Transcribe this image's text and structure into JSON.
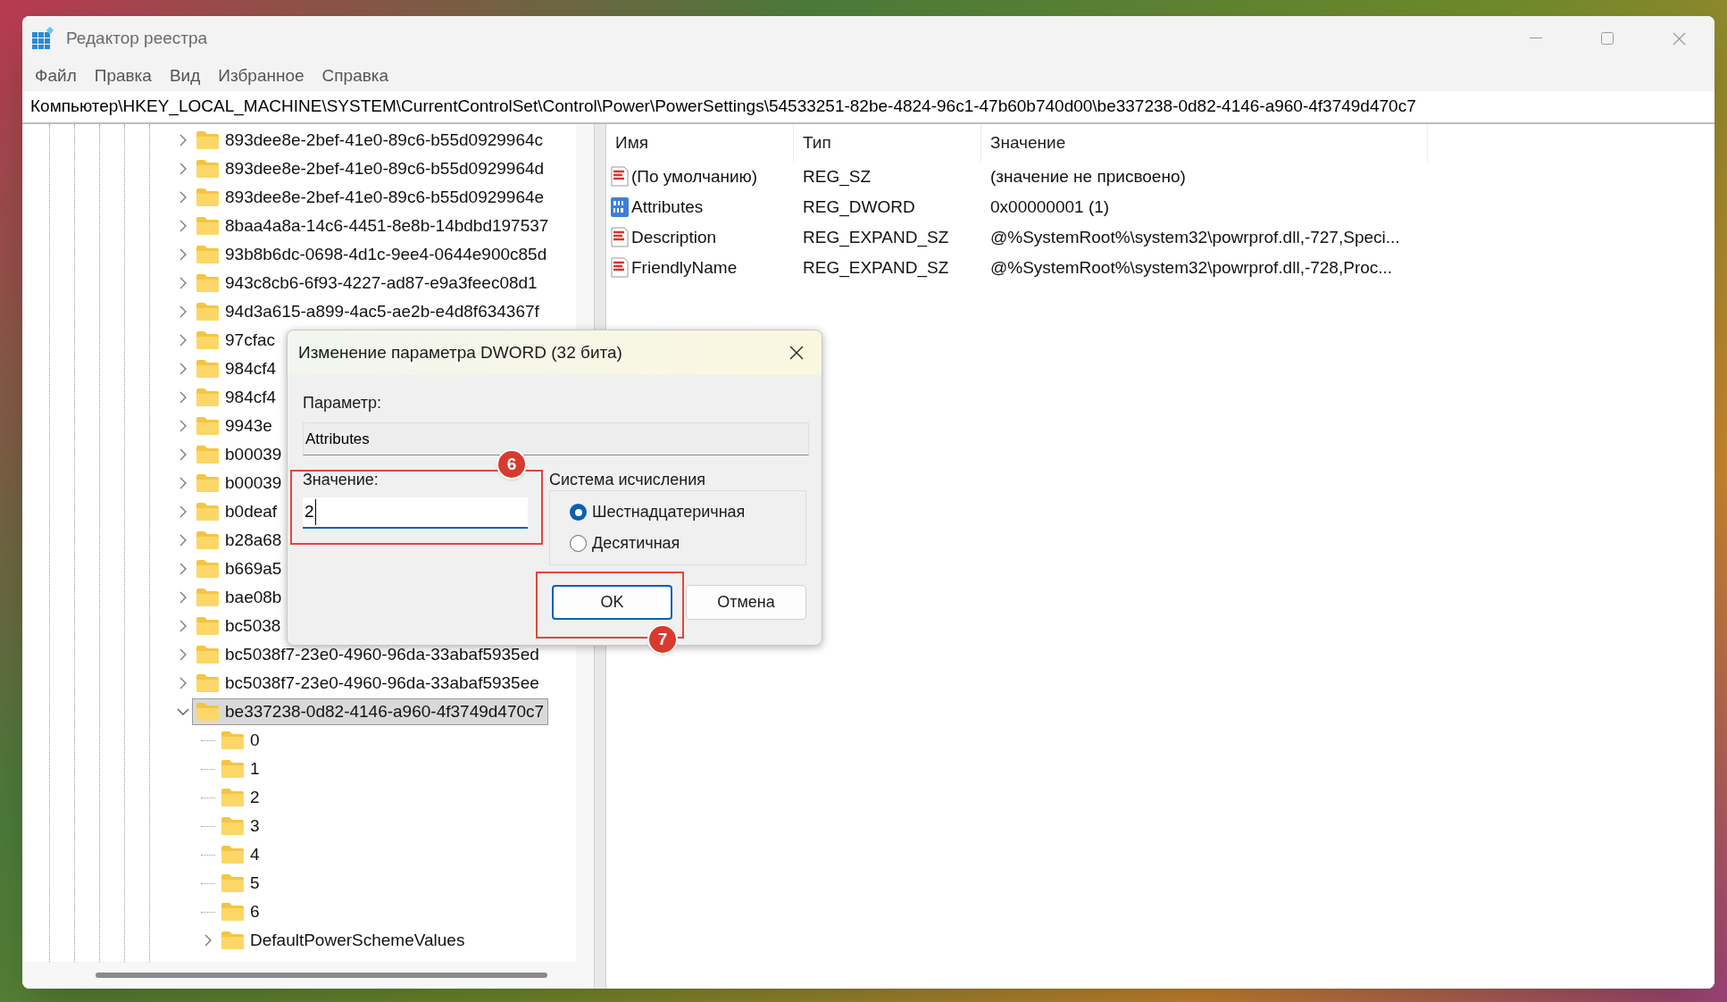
{
  "window": {
    "title": "Редактор реестра"
  },
  "menu": [
    "Файл",
    "Правка",
    "Вид",
    "Избранное",
    "Справка"
  ],
  "address_bar": "Компьютер\\HKEY_LOCAL_MACHINE\\SYSTEM\\CurrentControlSet\\Control\\Power\\PowerSettings\\54533251-82be-4824-96c1-47b60b740d00\\be337238-0d82-4146-a960-4f3749d470c7",
  "tree": {
    "items": [
      {
        "label": "893dee8e-2bef-41e0-89c6-b55d0929964c",
        "expandable": true,
        "expanded": false,
        "selected": false
      },
      {
        "label": "893dee8e-2bef-41e0-89c6-b55d0929964d",
        "expandable": true,
        "expanded": false,
        "selected": false
      },
      {
        "label": "893dee8e-2bef-41e0-89c6-b55d0929964e",
        "expandable": true,
        "expanded": false,
        "selected": false
      },
      {
        "label": "8baa4a8a-14c6-4451-8e8b-14bdbd197537",
        "expandable": true,
        "expanded": false,
        "selected": false
      },
      {
        "label": "93b8b6dc-0698-4d1c-9ee4-0644e900c85d",
        "expandable": true,
        "expanded": false,
        "selected": false
      },
      {
        "label": "943c8cb6-6f93-4227-ad87-e9a3feec08d1",
        "expandable": true,
        "expanded": false,
        "selected": false
      },
      {
        "label": "94d3a615-a899-4ac5-ae2b-e4d8f634367f",
        "expandable": true,
        "expanded": false,
        "selected": false
      },
      {
        "label": "97cfac",
        "expandable": true,
        "expanded": false,
        "selected": false
      },
      {
        "label": "984cf4",
        "expandable": true,
        "expanded": false,
        "selected": false
      },
      {
        "label": "984cf4",
        "expandable": true,
        "expanded": false,
        "selected": false
      },
      {
        "label": "9943e",
        "expandable": true,
        "expanded": false,
        "selected": false
      },
      {
        "label": "b00039",
        "expandable": true,
        "expanded": false,
        "selected": false
      },
      {
        "label": "b00039",
        "expandable": true,
        "expanded": false,
        "selected": false
      },
      {
        "label": "b0deaf",
        "expandable": true,
        "expanded": false,
        "selected": false
      },
      {
        "label": "b28a68",
        "expandable": true,
        "expanded": false,
        "selected": false
      },
      {
        "label": "b669a5",
        "expandable": true,
        "expanded": false,
        "selected": false
      },
      {
        "label": "bae08b",
        "expandable": true,
        "expanded": false,
        "selected": false
      },
      {
        "label": "bc5038",
        "expandable": true,
        "expanded": false,
        "selected": false
      },
      {
        "label": "bc5038f7-23e0-4960-96da-33abaf5935ed",
        "expandable": true,
        "expanded": false,
        "selected": false
      },
      {
        "label": "bc5038f7-23e0-4960-96da-33abaf5935ee",
        "expandable": true,
        "expanded": false,
        "selected": false
      },
      {
        "label": "be337238-0d82-4146-a960-4f3749d470c7",
        "expandable": true,
        "expanded": true,
        "selected": true,
        "children": [
          {
            "label": "0",
            "expandable": false,
            "selected": false
          },
          {
            "label": "1",
            "expandable": false,
            "selected": false
          },
          {
            "label": "2",
            "expandable": false,
            "selected": false
          },
          {
            "label": "3",
            "expandable": false,
            "selected": false
          },
          {
            "label": "4",
            "expandable": false,
            "selected": false
          },
          {
            "label": "5",
            "expandable": false,
            "selected": false
          },
          {
            "label": "6",
            "expandable": false,
            "selected": false
          },
          {
            "label": "DefaultPowerSchemeValues",
            "expandable": true,
            "expanded": false,
            "selected": false
          }
        ]
      }
    ]
  },
  "values": {
    "columns": [
      "Имя",
      "Тип",
      "Значение"
    ],
    "rows": [
      {
        "kind": "string",
        "name": "(По умолчанию)",
        "type": "REG_SZ",
        "data": "(значение не присвоено)"
      },
      {
        "kind": "binary",
        "name": "Attributes",
        "type": "REG_DWORD",
        "data": "0x00000001 (1)"
      },
      {
        "kind": "string",
        "name": "Description",
        "type": "REG_EXPAND_SZ",
        "data": "@%SystemRoot%\\system32\\powrprof.dll,-727,Speci..."
      },
      {
        "kind": "string",
        "name": "FriendlyName",
        "type": "REG_EXPAND_SZ",
        "data": "@%SystemRoot%\\system32\\powrprof.dll,-728,Proc..."
      }
    ]
  },
  "dialog": {
    "title": "Изменение параметра DWORD (32 бита)",
    "parameter_label": "Параметр:",
    "parameter_value": "Attributes",
    "value_label": "Значение:",
    "value": "2",
    "base_group": "Система исчисления",
    "radios": [
      {
        "label": "Шестнадцатеричная",
        "selected": true
      },
      {
        "label": "Десятичная",
        "selected": false
      }
    ],
    "buttons": [
      {
        "label": "OK",
        "default": true
      },
      {
        "label": "Отмена",
        "default": false
      }
    ],
    "annotations": [
      {
        "label": "6"
      },
      {
        "label": "7"
      }
    ]
  }
}
